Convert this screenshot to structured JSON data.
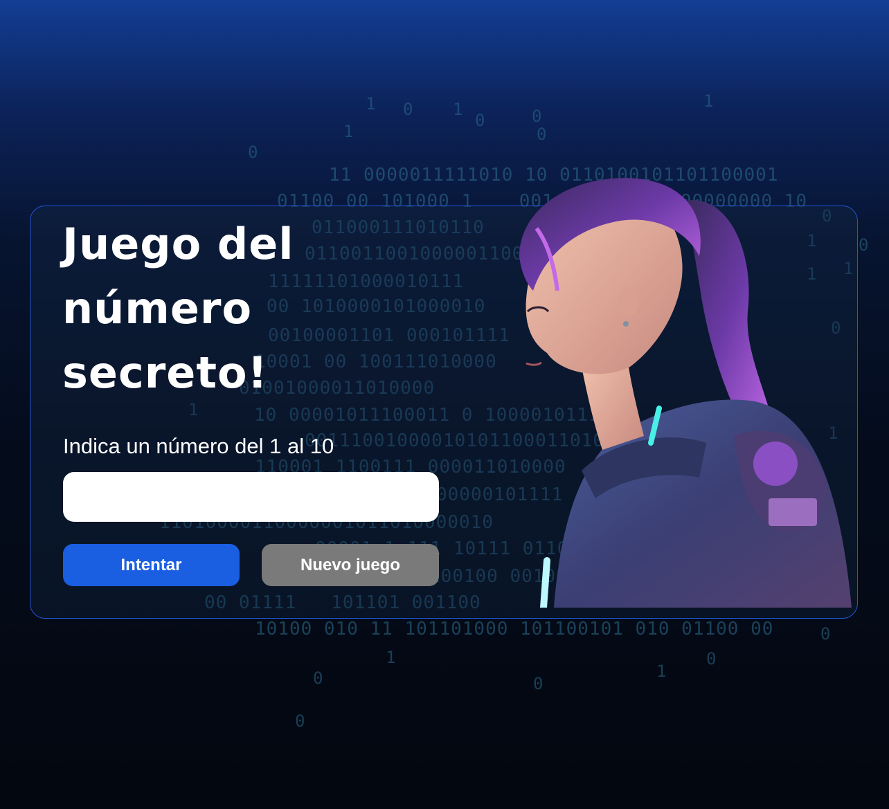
{
  "game": {
    "title": "Juego del número secreto!",
    "prompt": "Indica un número del 1 al 10",
    "input_value": "",
    "try_button_label": "Intentar",
    "new_game_button_label": "Nuevo juego"
  },
  "background": {
    "binary_lines": [
      "11 0000011111010 10 0110100101101100001",
      "01100 00 101000 1    001           00000000 10",
      "011000111010110",
      "0110011001000001100",
      "11111101000010111",
      "00 1010000101000010",
      "00100001101 000101111",
      "10001 00 100111010000",
      "01001000011010000",
      "10 00001011100011 0 1000010111",
      "001110010000101011000110100",
      "110001 1100111 000011010000",
      "00000101111",
      "11010000110000001011010000010",
      "00001 1 111 10111 01101",
      "10010 100100 0010111",
      "00 01111   101101 001100",
      "10100 010 11 101101000 101100101 010 01100 00"
    ],
    "binary_digits": [
      "1",
      "0",
      "1",
      "0",
      "0",
      "1",
      "0",
      "0",
      "1",
      "1",
      "0",
      "1",
      "1",
      "0",
      "0",
      "1",
      "1",
      "0",
      "0",
      "1",
      "1",
      "0",
      "0",
      "0"
    ]
  },
  "colors": {
    "accent": "#1a5ee2",
    "secondary_button": "#7a7a7a",
    "card_border": "#2456d8",
    "character_hair": "#9b4fd6",
    "character_glow": "#49f0e6"
  }
}
